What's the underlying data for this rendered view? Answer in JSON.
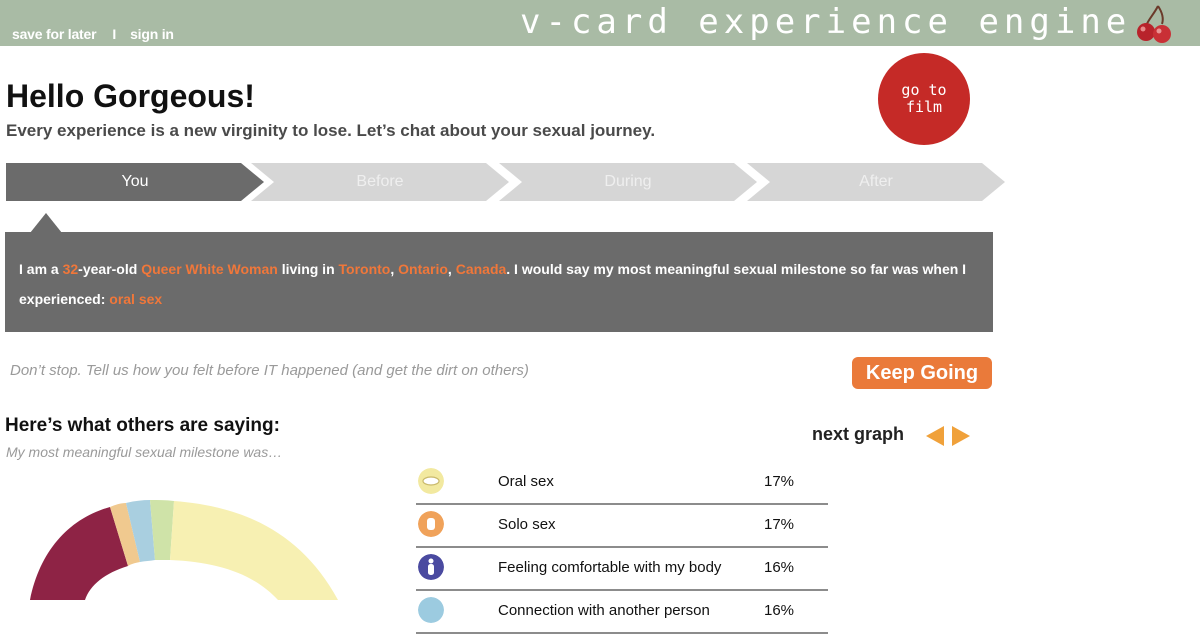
{
  "header": {
    "save_label": "save for later",
    "separator": "I",
    "signin_label": "sign in",
    "brand": "v-card experience engine"
  },
  "intro": {
    "title": "Hello Gorgeous!",
    "subtitle": "Every experience is a new virginity to lose. Let’s chat about your sexual journey."
  },
  "go_to_film": "go to film",
  "steps": [
    {
      "label": "You",
      "state": "active"
    },
    {
      "label": "Before",
      "state": "inactive"
    },
    {
      "label": "During",
      "state": "inactive"
    },
    {
      "label": "After",
      "state": "inactive"
    }
  ],
  "summary": {
    "p1": "I am a ",
    "age": "32",
    "p2": "-year-old ",
    "identity": "Queer White Woman",
    "p3": " living in ",
    "city": "Toronto",
    "c1": ", ",
    "province": "Ontario",
    "c2": ", ",
    "country": "Canada",
    "p4": ". I would say my most meaningful sexual milestone so far was when I experienced: ",
    "milestone": "oral sex"
  },
  "prompt": "Don’t stop. Tell us how you felt before IT happened (and get the dirt on others)",
  "keep_going": "Keep Going",
  "others": {
    "title": "Here’s what others are saying:",
    "question": "My most meaningful sexual milestone was…",
    "next_graph": "next graph"
  },
  "legend": [
    {
      "label": "Oral sex",
      "pct": "17%",
      "icon": "lips-icon",
      "color": "#f2e9a0"
    },
    {
      "label": "Solo sex",
      "pct": "17%",
      "icon": "hand-icon",
      "color": "#f0a25a"
    },
    {
      "label": "Feeling comfortable with my body",
      "pct": "16%",
      "icon": "body-icon",
      "color": "#4a4aa0"
    },
    {
      "label": "Connection with another person",
      "pct": "16%",
      "icon": "heart-icon",
      "color": "#9ccbe0"
    }
  ],
  "colors": {
    "topbar": "#a9bba5",
    "accent_orange": "#ea7a3a",
    "go_to_film_red": "#c52a27",
    "active_step": "#6b6b6b",
    "inactive_step": "#d6d6d6"
  }
}
